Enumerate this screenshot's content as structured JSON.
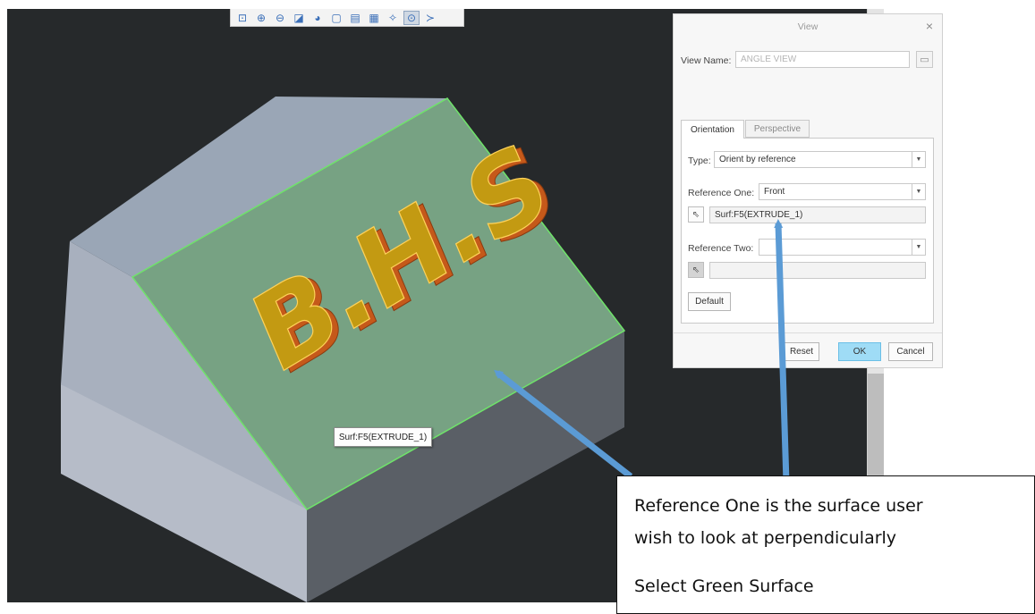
{
  "toolbar": {
    "icons": [
      "zoom-fit-icon",
      "zoom-in-icon",
      "zoom-out-icon",
      "repaint-icon",
      "display-style-icon",
      "view-manager-icon",
      "saved-orientations-icon",
      "datum-display-icon",
      "annotation-icon",
      "spin-center-icon",
      "more-icon"
    ]
  },
  "model": {
    "extruded_text": "BHS",
    "tooltip": "Surf:F5(EXTRUDE_1)",
    "colors": {
      "viewport_bg": "#26292b",
      "top_face": "#9aa6b6",
      "left_face": "#a8b0be",
      "front_face": "#5a5f66",
      "selected_surface": "#77a283",
      "edge_highlight": "#6fe36a",
      "text_fill": "#c39a12",
      "text_side": "#c5591a"
    }
  },
  "dialog": {
    "title": "View",
    "close": "×",
    "view_name_label": "View Name:",
    "view_name_value": "ANGLE VIEW",
    "tabs": {
      "orientation": "Orientation",
      "perspective": "Perspective"
    },
    "type_label": "Type:",
    "type_value": "Orient by reference",
    "ref_one_label": "Reference One:",
    "ref_one_value": "Front",
    "ref_one_selection": "Surf:F5(EXTRUDE_1)",
    "ref_two_label": "Reference Two:",
    "ref_two_value": "",
    "ref_two_selection": "",
    "default_button": "Default",
    "reset_button": "Reset",
    "ok_button": "OK",
    "cancel_button": "Cancel"
  },
  "callout": {
    "line1": "Reference One is the surface user",
    "line2": "wish to look at perpendicularly",
    "line3": "Select Green Surface",
    "arrow_color": "#5b9bd5"
  }
}
